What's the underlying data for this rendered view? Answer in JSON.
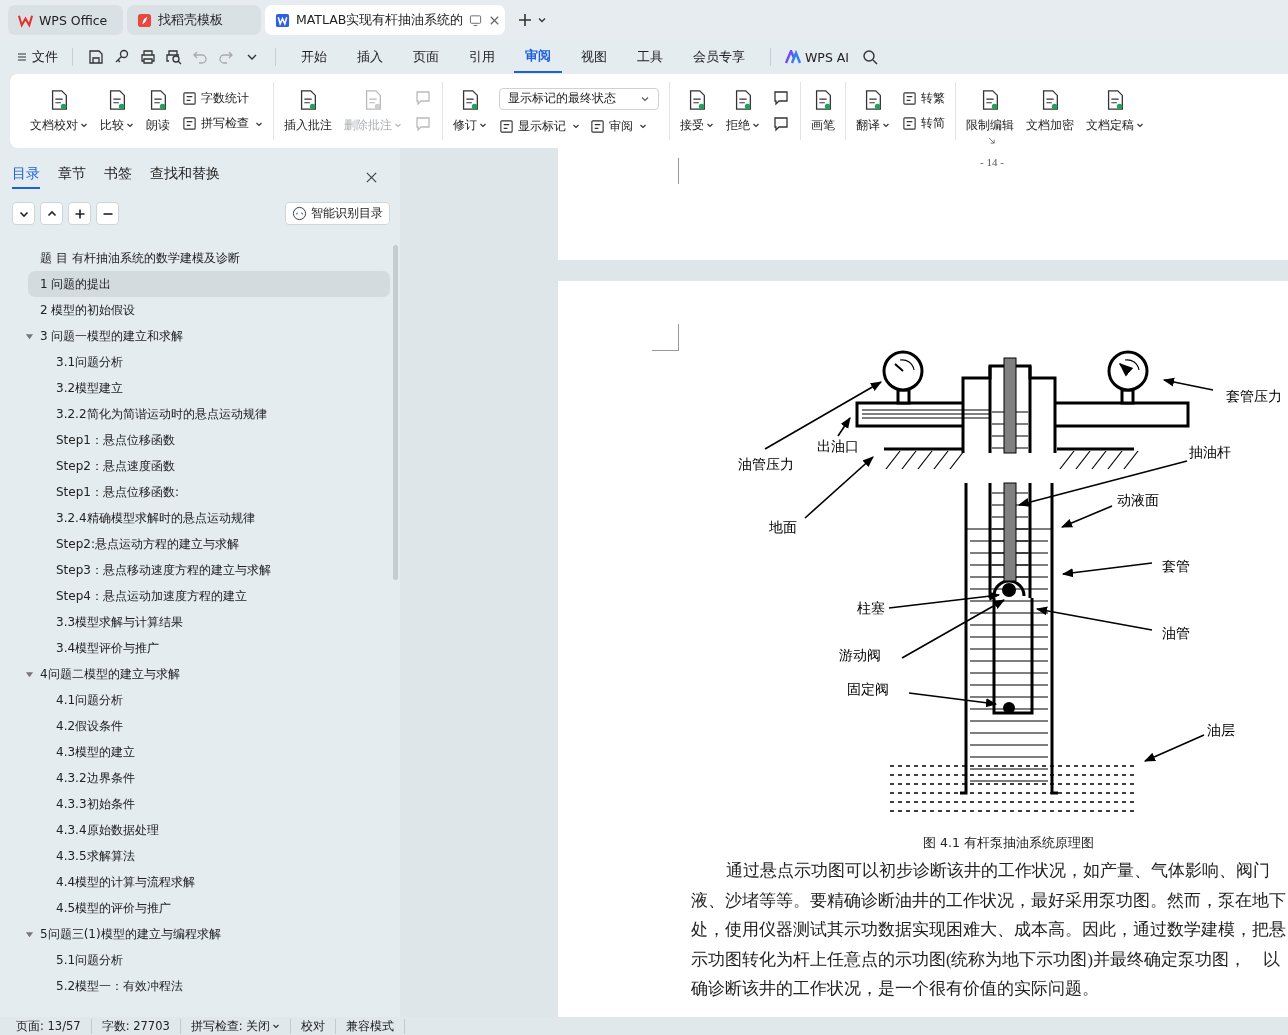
{
  "tabs": [
    {
      "label": "WPS Office",
      "kind": "home",
      "selected": false
    },
    {
      "label": "找稻壳模板",
      "kind": "template",
      "selected": false
    },
    {
      "label": "MATLAB实现有杆抽油系统的",
      "kind": "doc",
      "selected": true
    }
  ],
  "menu": {
    "file": "文件",
    "ai": "WPS AI",
    "tabs": [
      {
        "label": "开始",
        "selected": false
      },
      {
        "label": "插入",
        "selected": false
      },
      {
        "label": "页面",
        "selected": false
      },
      {
        "label": "引用",
        "selected": false
      },
      {
        "label": "审阅",
        "selected": true
      },
      {
        "label": "视图",
        "selected": false
      },
      {
        "label": "工具",
        "selected": false
      },
      {
        "label": "会员专享",
        "selected": false
      }
    ]
  },
  "ribbon": [
    {
      "columns": [
        {
          "kind": "big",
          "label": "文档校对",
          "menu": true,
          "disabled": false
        },
        {
          "kind": "big",
          "label": "比较",
          "menu": true,
          "disabled": false
        },
        {
          "kind": "big",
          "label": "朗读",
          "menu": false,
          "disabled": false
        },
        {
          "kind": "stack",
          "rows": [
            [
              {
                "kind": "small",
                "label": "字数统计",
                "menu": false,
                "disabled": false
              }
            ],
            [
              {
                "kind": "small",
                "label": "拼写检查",
                "menu": true,
                "disabled": false
              }
            ]
          ]
        }
      ]
    },
    {
      "columns": [
        {
          "kind": "big",
          "label": "插入批注",
          "menu": false,
          "disabled": false
        },
        {
          "kind": "big",
          "label": "删除批注",
          "menu": true,
          "disabled": true
        },
        {
          "kind": "stack",
          "rows": [
            [
              {
                "kind": "icon",
                "disabled": true
              }
            ],
            [
              {
                "kind": "icon",
                "disabled": true
              }
            ]
          ]
        }
      ]
    },
    {
      "columns": [
        {
          "kind": "big",
          "label": "修订",
          "menu": true,
          "disabled": false
        },
        {
          "kind": "stack",
          "rows": [
            [
              {
                "kind": "select",
                "label": "显示标记的最终状态",
                "disabled": false
              }
            ],
            [
              {
                "kind": "small",
                "label": "显示标记",
                "menu": true,
                "disabled": false
              },
              {
                "kind": "small",
                "label": "审阅",
                "menu": true,
                "disabled": false
              }
            ]
          ]
        }
      ]
    },
    {
      "columns": [
        {
          "kind": "big",
          "label": "接受",
          "menu": true,
          "disabled": false
        },
        {
          "kind": "big",
          "label": "拒绝",
          "menu": true,
          "disabled": false
        },
        {
          "kind": "stack",
          "rows": [
            [
              {
                "kind": "icon",
                "disabled": false
              }
            ],
            [
              {
                "kind": "icon",
                "disabled": false
              }
            ]
          ]
        }
      ]
    },
    {
      "columns": [
        {
          "kind": "big",
          "label": "画笔",
          "menu": false,
          "disabled": false
        }
      ]
    },
    {
      "columns": [
        {
          "kind": "big",
          "label": "翻译",
          "menu": true,
          "disabled": false
        },
        {
          "kind": "stack",
          "rows": [
            [
              {
                "kind": "small",
                "label": "转繁",
                "menu": false,
                "disabled": false
              }
            ],
            [
              {
                "kind": "small",
                "label": "转简",
                "menu": false,
                "disabled": false
              }
            ]
          ]
        }
      ]
    },
    {
      "columns": [
        {
          "kind": "big",
          "label": "限制编辑",
          "menu": false,
          "disabled": false
        },
        {
          "kind": "big",
          "label": "文档加密",
          "menu": false,
          "disabled": false
        },
        {
          "kind": "big",
          "label": "文档定稿",
          "menu": true,
          "disabled": false
        }
      ]
    }
  ],
  "sidebar": {
    "tabs": [
      {
        "label": "目录",
        "selected": true
      },
      {
        "label": "章节",
        "selected": false
      },
      {
        "label": "书签",
        "selected": false
      },
      {
        "label": "查找和替换",
        "selected": false
      }
    ],
    "smart_button": "智能识别目录",
    "toc": [
      {
        "label": "题 目  有杆抽油系统的数学建模及诊断",
        "selected": false
      },
      {
        "label": "1  问题的提出",
        "selected": true
      },
      {
        "label": "2 模型的初始假设",
        "selected": false
      },
      {
        "label": "3 问题一模型的建立和求解",
        "selected": false,
        "expanded": true,
        "children": [
          {
            "label": "3.1问题分析",
            "selected": false
          },
          {
            "label": "3.2模型建立",
            "selected": false
          },
          {
            "label": "3.2.2简化为简谐运动时的悬点运动规律",
            "selected": false
          },
          {
            "label": "Step1：悬点位移函数",
            "selected": false
          },
          {
            "label": "Step2：悬点速度函数",
            "selected": false
          },
          {
            "label": "Step1：悬点位移函数:",
            "selected": false
          },
          {
            "label": "3.2.4精确模型求解时的悬点运动规律",
            "selected": false
          },
          {
            "label": "Step2:悬点运动方程的建立与求解",
            "selected": false
          },
          {
            "label": "Step3：悬点移动速度方程的建立与求解",
            "selected": false
          },
          {
            "label": "Step4：悬点运动加速度方程的建立",
            "selected": false
          },
          {
            "label": "3.3模型求解与计算结果",
            "selected": false
          },
          {
            "label": "3.4模型评价与推广",
            "selected": false
          }
        ]
      },
      {
        "label": "4问题二模型的建立与求解",
        "selected": false,
        "expanded": true,
        "children": [
          {
            "label": "4.1问题分析",
            "selected": false
          },
          {
            "label": "4.2假设条件",
            "selected": false
          },
          {
            "label": "4.3模型的建立",
            "selected": false
          },
          {
            "label": "4.3.2边界条件",
            "selected": false
          },
          {
            "label": "4.3.3初始条件",
            "selected": false
          },
          {
            "label": "4.3.4原始数据处理",
            "selected": false
          },
          {
            "label": "4.3.5求解算法",
            "selected": false
          },
          {
            "label": "4.4模型的计算与流程求解",
            "selected": false
          },
          {
            "label": "4.5模型的评价与推广",
            "selected": false
          }
        ]
      },
      {
        "label": "5问题三(1)模型的建立与编程求解",
        "selected": false,
        "expanded": true,
        "children": [
          {
            "label": "5.1问题分析",
            "selected": false
          },
          {
            "label": "5.2模型一：有效冲程法",
            "selected": false
          }
        ]
      }
    ]
  },
  "document": {
    "page_number": "- 14 -",
    "figure": {
      "labels": [
        "套管压力",
        "油管压力",
        "出油口",
        "抽油杆",
        "动液面",
        "地面",
        "套管",
        "柱塞",
        "油管",
        "游动阀",
        "固定阀",
        "油层"
      ],
      "caption": "图 4.1 有杆泵抽油系统原理图"
    },
    "paragraph": [
      "通过悬点示功图可以初步诊断该井的工作状况，如产量、气体影响、阀门",
      "液、沙堵等等。要精确诊断油井的工作状况，最好采用泵功图。然而，泵在地下",
      "处，使用仪器测试其示功数据实现困难大、成本高。因此，通过数学建模，把悬",
      "示功图转化为杆上任意点的示功图(统称为地下示功图)并最终确定泵功图，　以",
      "确诊断该井的工作状况，是一个很有价值的实际问题。"
    ]
  },
  "status_bar": [
    {
      "label": "页面: 13/57",
      "menu": false
    },
    {
      "label": "字数: 27703",
      "menu": false
    },
    {
      "label": "拼写检查: 关闭",
      "menu": true
    },
    {
      "label": "校对",
      "menu": false
    },
    {
      "label": "兼容模式",
      "menu": false
    }
  ]
}
